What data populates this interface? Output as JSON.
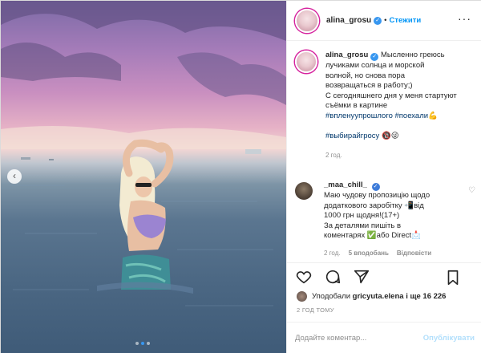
{
  "post": {
    "username": "alina_grosu",
    "follow_label": "Стежити",
    "caption": {
      "line1": "Мысленно греюсь",
      "line2": "лучиками солнца и морской",
      "line3": "волной, но снова пора",
      "line4": "возвращаться в работу;)",
      "line5": "С сегодняшнего дня у меня стартуют",
      "line6": "съёмки в картине",
      "tags1": "#вплену",
      "tags1b": "упрошлого #поехали",
      "tags1_emoji": "💪",
      "tags2": "#выбирайгросу",
      "tags2_emoji": "🔞😜",
      "time": "2 год."
    },
    "comment": {
      "username": "_maa_chill_",
      "line1": "Маю чудову пропозицію щодо",
      "line2": "додаткового заробітку 📲від",
      "line3": "1000 грн щодня!(17+)",
      "line4": "За деталями пишіть в",
      "line5": "коментарях ✅або Direct📩",
      "time": "2 год.",
      "likes": "5 вподобань",
      "reply": "Відповісти"
    },
    "likes_prefix": "Уподобали",
    "likes_user": "gricyuta.elena",
    "likes_suffix": "і ще 16 226",
    "timestamp": "2 ГОД ТОМУ",
    "comment_placeholder": "Додайте коментар...",
    "publish_label": "Опублікувати"
  },
  "colors": {
    "accent": "#0095f6",
    "muted": "#8e8e8e",
    "publish_disabled": "#b2dffc"
  },
  "icons": {
    "heart": "heart-icon",
    "comment": "comment-icon",
    "share": "share-icon",
    "save": "bookmark-icon",
    "more": "more-icon"
  }
}
